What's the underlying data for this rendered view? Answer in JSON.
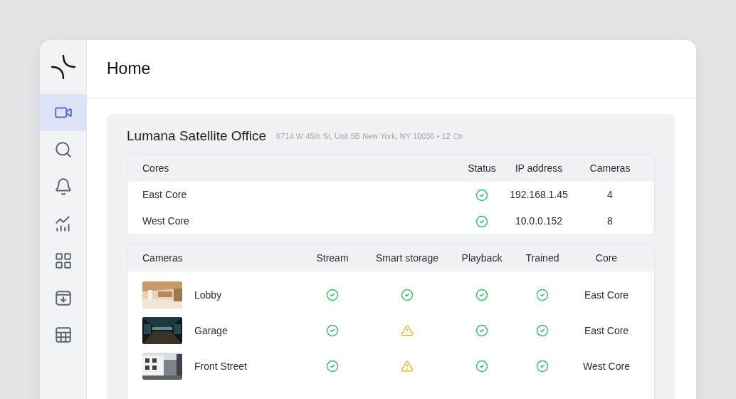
{
  "sidebar": {
    "items": [
      {
        "selected": true
      },
      {
        "selected": false
      },
      {
        "selected": false
      },
      {
        "selected": false
      },
      {
        "selected": false
      },
      {
        "selected": false
      },
      {
        "selected": false
      }
    ]
  },
  "header": {
    "title": "Home"
  },
  "site": {
    "name": "Lumana Satellite Office",
    "details": "6714 W 45th St, Unit 5B New York, NY 10036 • 12"
  },
  "cores": {
    "columns": [
      "Cores",
      "Status",
      "IP address",
      "Cameras"
    ],
    "rows": [
      {
        "name": "East Core",
        "status_ok": true,
        "ip": "192.168.1.45",
        "cameras": "4"
      },
      {
        "name": "West Core",
        "status_ok": true,
        "ip": "10.0.0.152",
        "cameras": "8"
      }
    ]
  },
  "cameras": {
    "columns": [
      "Cameras",
      "Stream",
      "Smart storage",
      "Playback",
      "Trained",
      "Core"
    ],
    "rows": [
      {
        "name": "Lobby",
        "stream_ok": true,
        "smart_storage_ok": true,
        "playback_ok": true,
        "trained_ok": true,
        "core": "East Core"
      },
      {
        "name": "Garage",
        "stream_ok": true,
        "smart_storage_ok": false,
        "playback_ok": true,
        "trained_ok": true,
        "core": "East Core"
      },
      {
        "name": "Front Street",
        "stream_ok": true,
        "smart_storage_ok": false,
        "playback_ok": true,
        "trained_ok": true,
        "core": "West Core"
      }
    ]
  }
}
